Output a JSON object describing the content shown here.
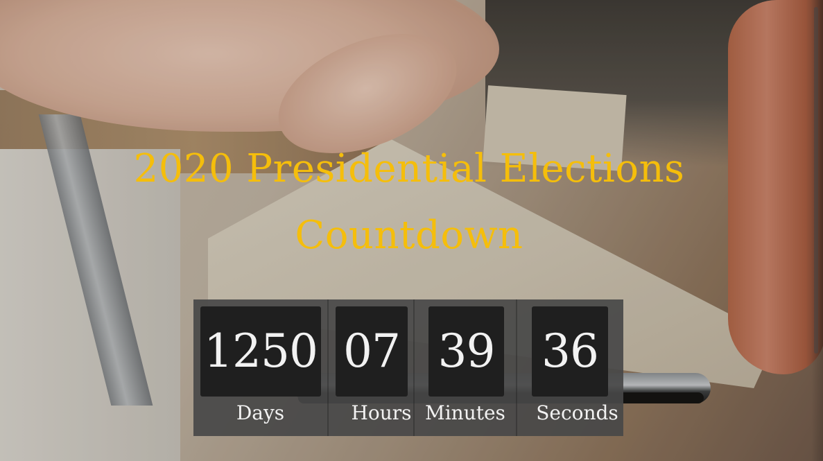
{
  "hero": {
    "title_line1": "2020 Presidential Elections",
    "title_line2": "Countdown",
    "title_color": "#f5be0b"
  },
  "countdown": {
    "units": [
      {
        "value": "1250",
        "label": "Days"
      },
      {
        "value": "07",
        "label": "Hours"
      },
      {
        "value": "39",
        "label": "Minutes"
      },
      {
        "value": "36",
        "label": "Seconds"
      }
    ]
  }
}
